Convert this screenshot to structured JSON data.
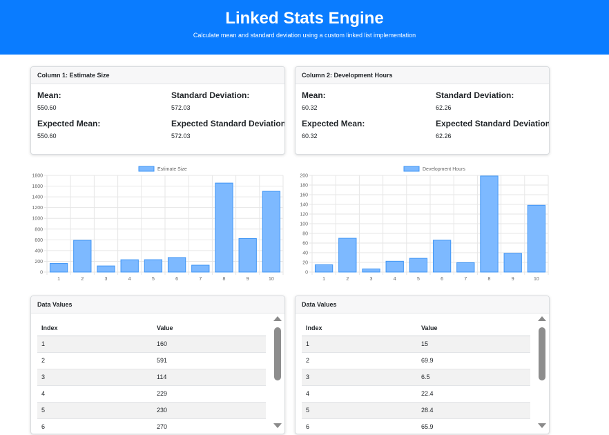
{
  "header": {
    "title": "Linked Stats Engine",
    "subtitle": "Calculate mean and standard deviation using a custom linked list implementation"
  },
  "columns": [
    {
      "title": "Column 1: Estimate Size",
      "stats": {
        "mean_label": "Mean:",
        "mean": "550.60",
        "std_label": "Standard Deviation:",
        "std": "572.03",
        "exp_mean_label": "Expected Mean:",
        "exp_mean": "550.60",
        "exp_std_label": "Expected Standard Deviation:",
        "exp_std": "572.03"
      },
      "table": {
        "title": "Data Values",
        "headers": [
          "Index",
          "Value"
        ],
        "rows": [
          [
            "1",
            "160"
          ],
          [
            "2",
            "591"
          ],
          [
            "3",
            "114"
          ],
          [
            "4",
            "229"
          ],
          [
            "5",
            "230"
          ],
          [
            "6",
            "270"
          ]
        ]
      }
    },
    {
      "title": "Column 2: Development Hours",
      "stats": {
        "mean_label": "Mean:",
        "mean": "60.32",
        "std_label": "Standard Deviation:",
        "std": "62.26",
        "exp_mean_label": "Expected Mean:",
        "exp_mean": "60.32",
        "exp_std_label": "Expected Standard Deviation:",
        "exp_std": "62.26"
      },
      "table": {
        "title": "Data Values",
        "headers": [
          "Index",
          "Value"
        ],
        "rows": [
          [
            "1",
            "15"
          ],
          [
            "2",
            "69.9"
          ],
          [
            "3",
            "6.5"
          ],
          [
            "4",
            "22.4"
          ],
          [
            "5",
            "28.4"
          ],
          [
            "6",
            "65.9"
          ]
        ]
      }
    }
  ],
  "colors": {
    "header_bg": "#0a7cff",
    "bar_fill": "#7db9ff",
    "bar_stroke": "#3f95f5"
  },
  "chart_data": [
    {
      "type": "bar",
      "categories": [
        "1",
        "2",
        "3",
        "4",
        "5",
        "6",
        "7",
        "8",
        "9",
        "10"
      ],
      "series": [
        {
          "name": "Estimate Size",
          "values": [
            160,
            591,
            114,
            229,
            230,
            270,
            128,
            1657,
            624,
            1503
          ]
        }
      ],
      "ylim": [
        0,
        1800
      ],
      "yticks": [
        0,
        200,
        400,
        600,
        800,
        1000,
        1200,
        1400,
        1600,
        1800
      ],
      "grid": true,
      "legend": "top"
    },
    {
      "type": "bar",
      "categories": [
        "1",
        "2",
        "3",
        "4",
        "5",
        "6",
        "7",
        "8",
        "9",
        "10"
      ],
      "series": [
        {
          "name": "Development Hours",
          "values": [
            15,
            69.9,
            6.5,
            22.4,
            28.4,
            65.9,
            19.4,
            198.7,
            38.8,
            138.2
          ]
        }
      ],
      "ylim": [
        0,
        200
      ],
      "yticks": [
        0,
        20,
        40,
        60,
        80,
        100,
        120,
        140,
        160,
        180,
        200
      ],
      "grid": true,
      "legend": "top"
    }
  ]
}
